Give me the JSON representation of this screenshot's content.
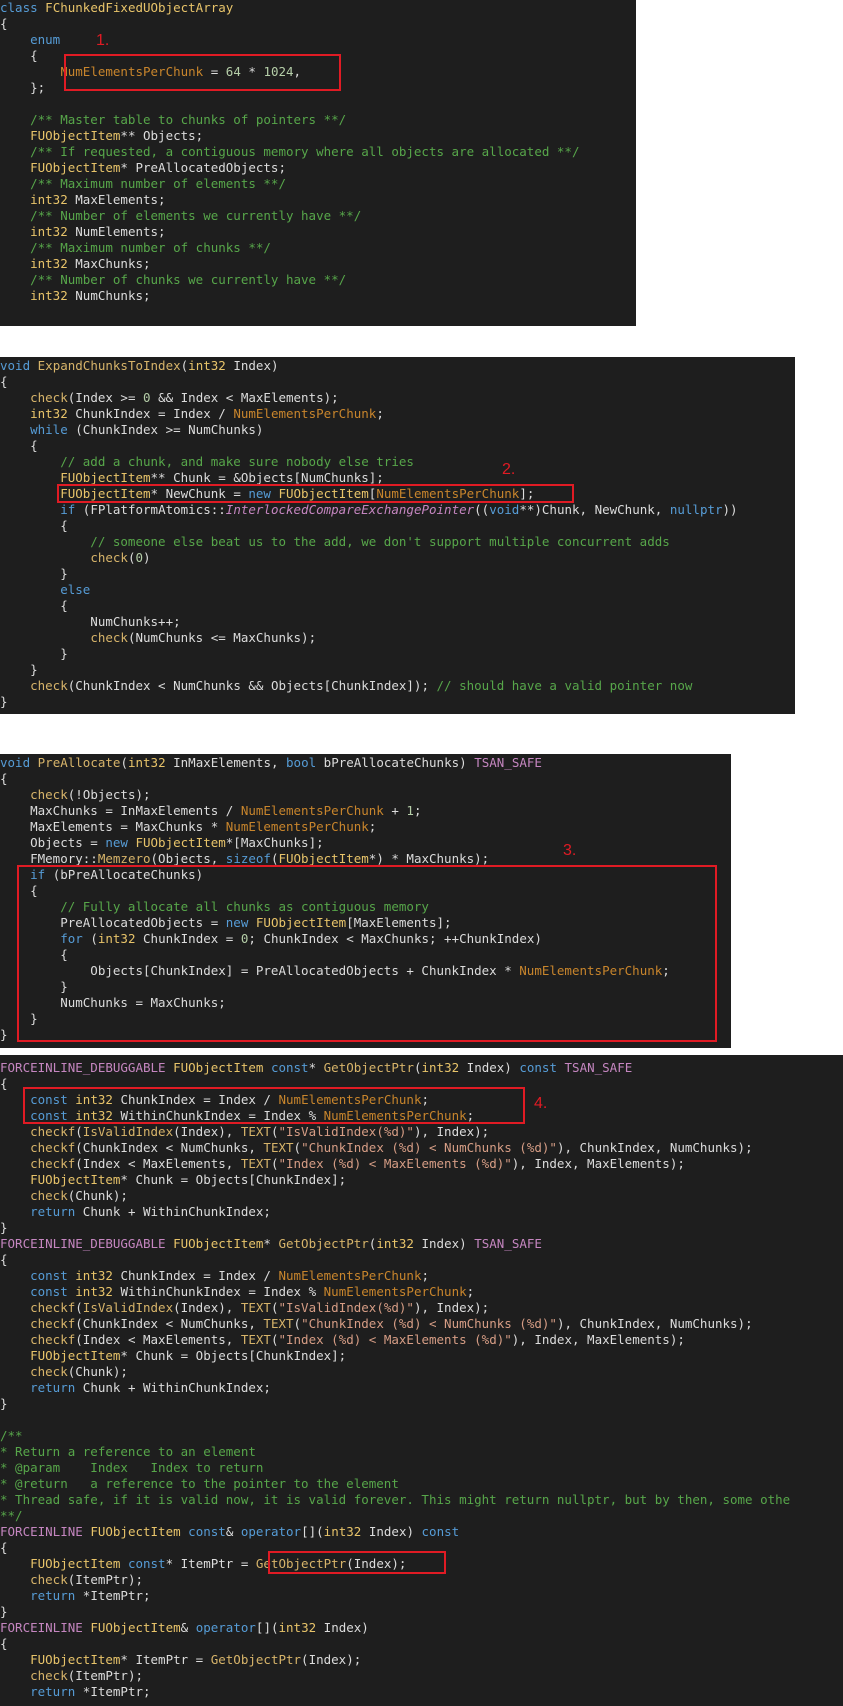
{
  "panels": [
    {
      "id": "chunked-array-class",
      "lines": [
        "class FChunkedFixedUObjectArray",
        "{",
        "    enum",
        "    {",
        "        NumElementsPerChunk = 64 * 1024,",
        "    };",
        "",
        "    /** Master table to chunks of pointers **/",
        "    FUObjectItem** Objects;",
        "    /** If requested, a contiguous memory where all objects are allocated **/",
        "    FUObjectItem* PreAllocatedObjects;",
        "    /** Maximum number of elements **/",
        "    int32 MaxElements;",
        "    /** Number of elements we currently have **/",
        "    int32 NumElements;",
        "    /** Maximum number of chunks **/",
        "    int32 MaxChunks;",
        "    /** Number of chunks we currently have **/",
        "    int32 NumChunks;"
      ],
      "annotation": "1."
    },
    {
      "id": "expand-chunks-to-index",
      "lines": [
        "void ExpandChunksToIndex(int32 Index)",
        "{",
        "    check(Index >= 0 && Index < MaxElements);",
        "    int32 ChunkIndex = Index / NumElementsPerChunk;",
        "    while (ChunkIndex >= NumChunks)",
        "    {",
        "        // add a chunk, and make sure nobody else tries",
        "        FUObjectItem** Chunk = &Objects[NumChunks];",
        "        FUObjectItem* NewChunk = new FUObjectItem[NumElementsPerChunk];",
        "        if (FPlatformAtomics::InterlockedCompareExchangePointer((void**)Chunk, NewChunk, nullptr))",
        "        {",
        "            // someone else beat us to the add, we don't support multiple concurrent adds",
        "            check(0)",
        "        }",
        "        else",
        "        {",
        "            NumChunks++;",
        "            check(NumChunks <= MaxChunks);",
        "        }",
        "    }",
        "    check(ChunkIndex < NumChunks && Objects[ChunkIndex]); // should have a valid pointer now",
        "}"
      ],
      "annotation": "2."
    },
    {
      "id": "pre-allocate",
      "lines": [
        "void PreAllocate(int32 InMaxElements, bool bPreAllocateChunks) TSAN_SAFE",
        "{",
        "    check(!Objects);",
        "    MaxChunks = InMaxElements / NumElementsPerChunk + 1;",
        "    MaxElements = MaxChunks * NumElementsPerChunk;",
        "    Objects = new FUObjectItem*[MaxChunks];",
        "    FMemory::Memzero(Objects, sizeof(FUObjectItem*) * MaxChunks);",
        "    if (bPreAllocateChunks)",
        "    {",
        "        // Fully allocate all chunks as contiguous memory",
        "        PreAllocatedObjects = new FUObjectItem[MaxElements];",
        "        for (int32 ChunkIndex = 0; ChunkIndex < MaxChunks; ++ChunkIndex)",
        "        {",
        "            Objects[ChunkIndex] = PreAllocatedObjects + ChunkIndex * NumElementsPerChunk;",
        "        }",
        "        NumChunks = MaxChunks;",
        "    }",
        "}"
      ],
      "annotation": "3."
    },
    {
      "id": "get-object-ptr",
      "lines": [
        "FORCEINLINE_DEBUGGABLE FUObjectItem const* GetObjectPtr(int32 Index) const TSAN_SAFE",
        "{",
        "    const int32 ChunkIndex = Index / NumElementsPerChunk;",
        "    const int32 WithinChunkIndex = Index % NumElementsPerChunk;",
        "    checkf(IsValidIndex(Index), TEXT(\"IsValidIndex(%d)\"), Index);",
        "    checkf(ChunkIndex < NumChunks, TEXT(\"ChunkIndex (%d) < NumChunks (%d)\"), ChunkIndex, NumChunks);",
        "    checkf(Index < MaxElements, TEXT(\"Index (%d) < MaxElements (%d)\"), Index, MaxElements);",
        "    FUObjectItem* Chunk = Objects[ChunkIndex];",
        "    check(Chunk);",
        "    return Chunk + WithinChunkIndex;",
        "}",
        "FORCEINLINE_DEBUGGABLE FUObjectItem* GetObjectPtr(int32 Index) TSAN_SAFE",
        "{",
        "    const int32 ChunkIndex = Index / NumElementsPerChunk;",
        "    const int32 WithinChunkIndex = Index % NumElementsPerChunk;",
        "    checkf(IsValidIndex(Index), TEXT(\"IsValidIndex(%d)\"), Index);",
        "    checkf(ChunkIndex < NumChunks, TEXT(\"ChunkIndex (%d) < NumChunks (%d)\"), ChunkIndex, NumChunks);",
        "    checkf(Index < MaxElements, TEXT(\"Index (%d) < MaxElements (%d)\"), Index, MaxElements);",
        "    FUObjectItem* Chunk = Objects[ChunkIndex];",
        "    check(Chunk);",
        "    return Chunk + WithinChunkIndex;",
        "}",
        "",
        "/**",
        "* Return a reference to an element",
        "* @param    Index   Index to return",
        "* @return   a reference to the pointer to the element",
        "* Thread safe, if it is valid now, it is valid forever. This might return nullptr, but by then, some othe",
        "**/",
        "FORCEINLINE FUObjectItem const& operator[](int32 Index) const",
        "{",
        "    FUObjectItem const* ItemPtr = GetObjectPtr(Index);",
        "    check(ItemPtr);",
        "    return *ItemPtr;",
        "}",
        "FORCEINLINE FUObjectItem& operator[](int32 Index)",
        "{",
        "    FUObjectItem* ItemPtr = GetObjectPtr(Index);",
        "    check(ItemPtr);",
        "    return *ItemPtr;"
      ],
      "annotation": "4."
    }
  ]
}
